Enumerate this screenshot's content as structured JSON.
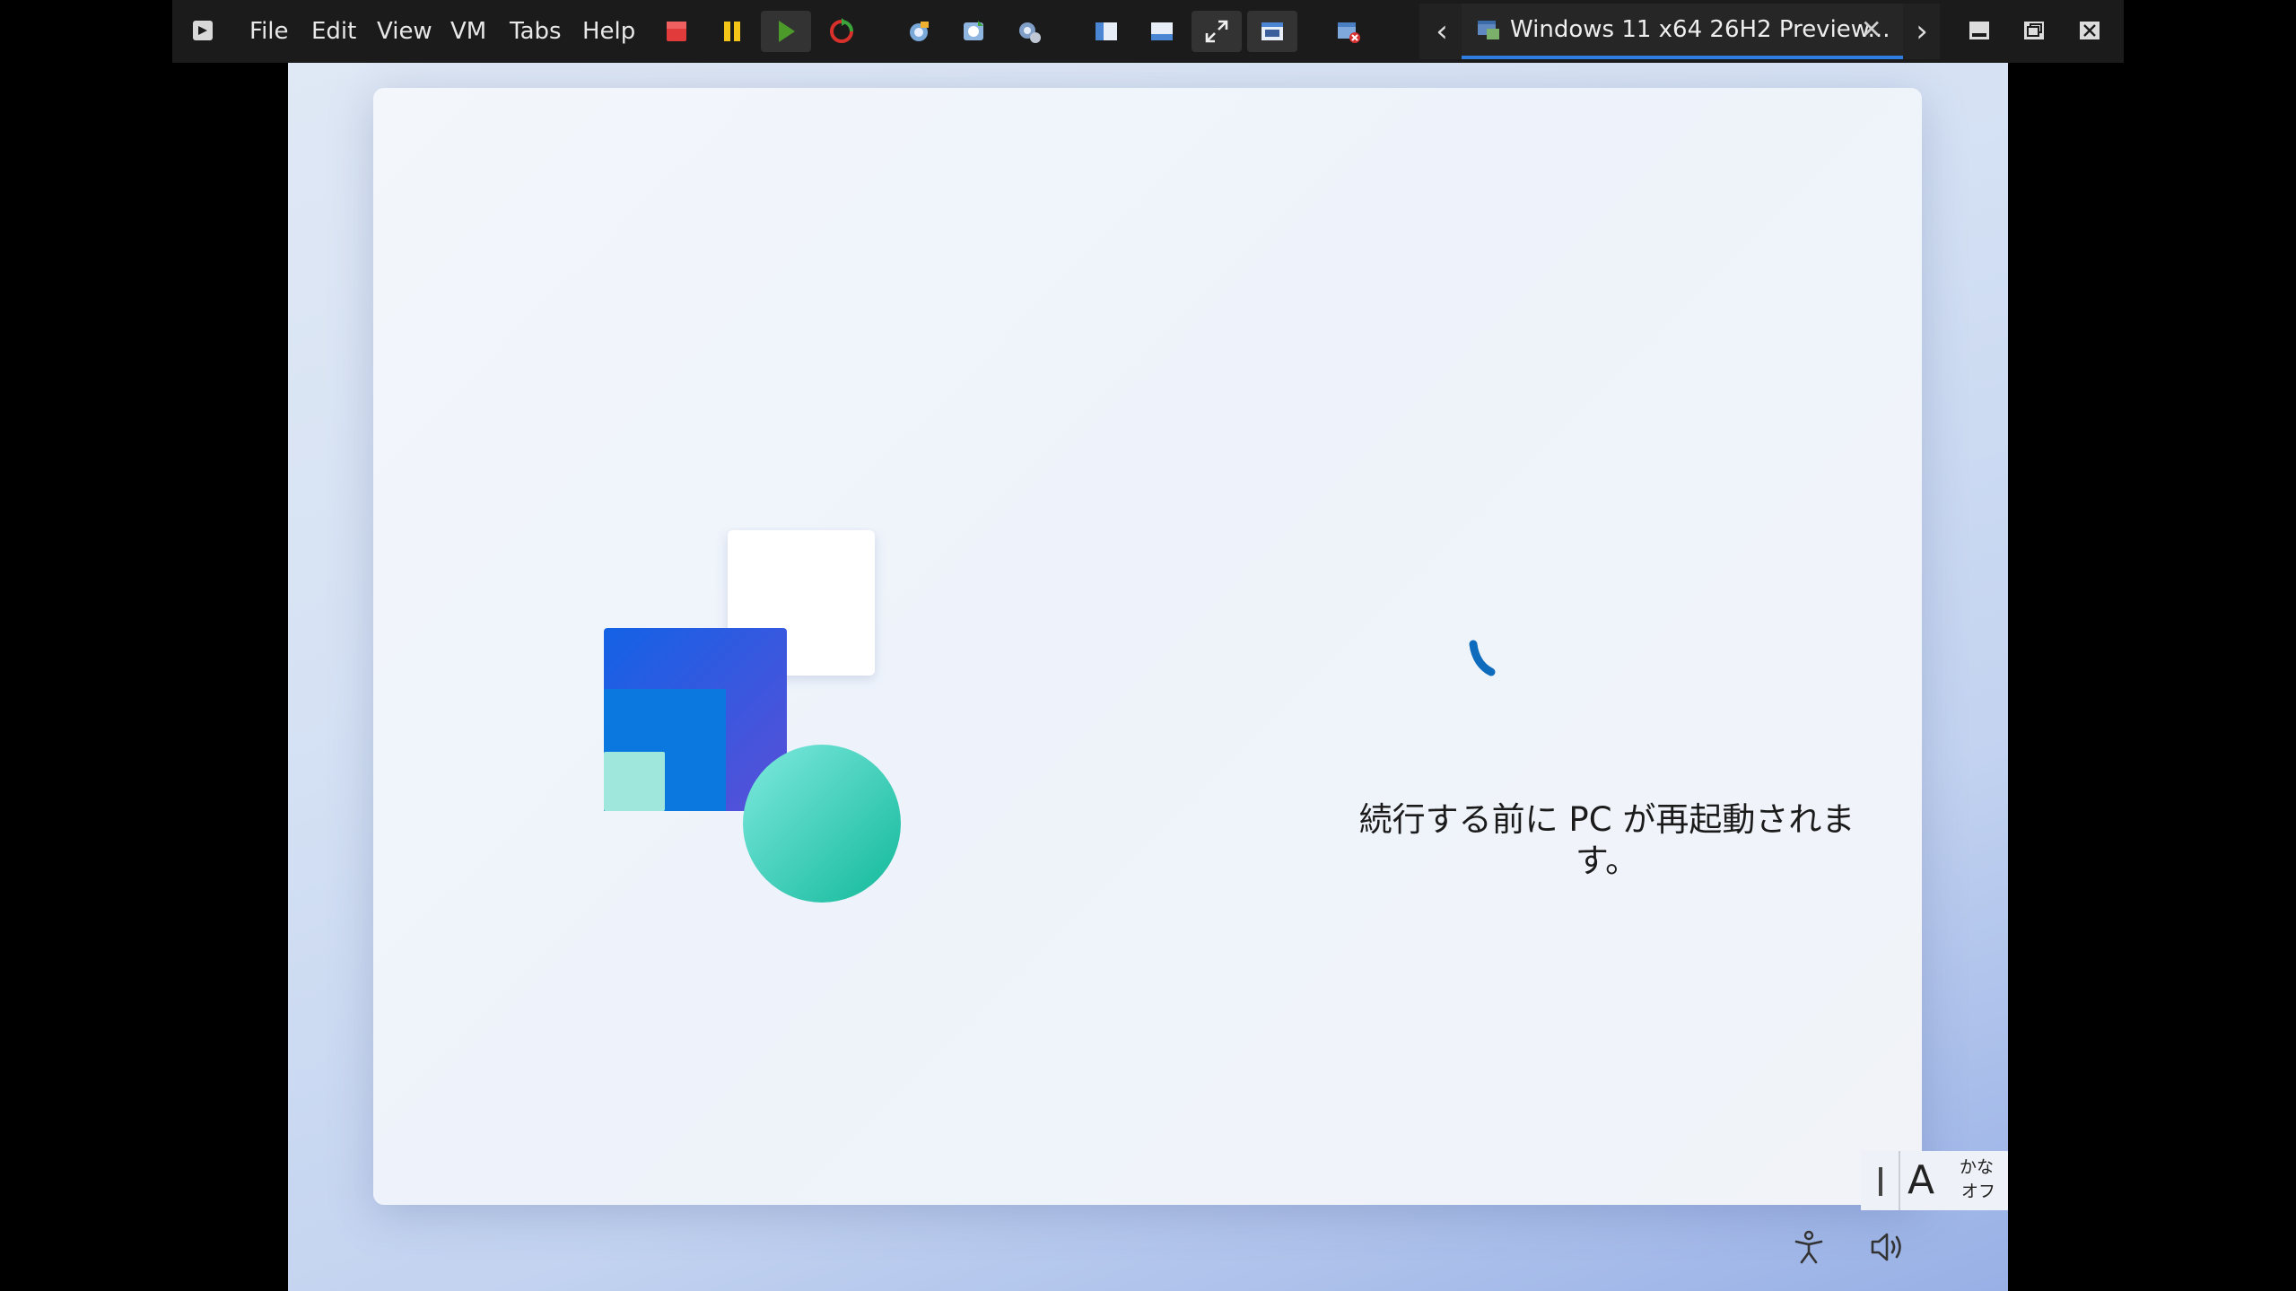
{
  "menu": {
    "file": "File",
    "edit": "Edit",
    "view": "View",
    "vm": "VM",
    "tabs": "Tabs",
    "help": "Help"
  },
  "toolbar_icons": [
    "power-off-icon",
    "suspend-icon",
    "power-on-icon",
    "reset-icon",
    "snapshot-take-icon",
    "snapshot-revert-icon",
    "snapshot-manager-icon",
    "console-view-icon",
    "thumbnail-view-icon",
    "fullscreen-icon",
    "unity-icon",
    "library-close-icon"
  ],
  "tab": {
    "title": "Windows 11 x64 26H2 Preview...",
    "prev_glyph": "‹",
    "next_glyph": "›",
    "close_glyph": "✕"
  },
  "guest": {
    "status_text": "続行する前に PC が再起動されます。",
    "ime": {
      "mode_letter": "A",
      "kana_line1": "かな",
      "kana_line2": "オフ"
    }
  },
  "colors": {
    "toolbar_bg": "#1b1b1b",
    "accent_blue": "#0f6cbd",
    "teal": "#2ad1b6"
  }
}
